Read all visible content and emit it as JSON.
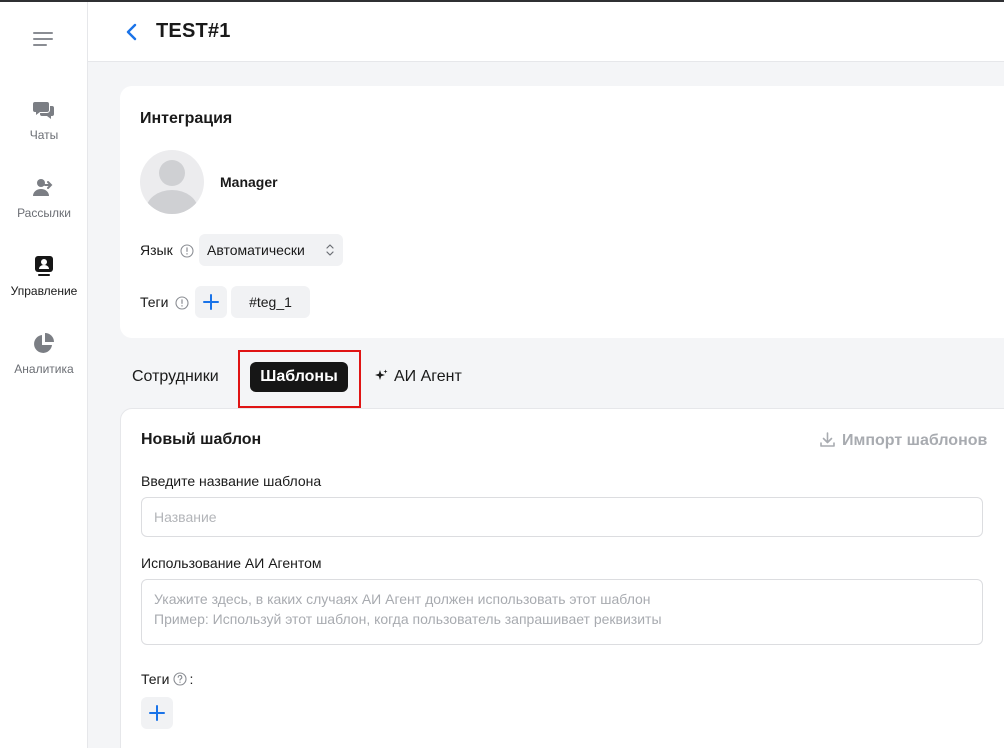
{
  "header": {
    "title": "TEST#1"
  },
  "sidebar": {
    "items": [
      {
        "label": "Чаты",
        "icon": "chats-icon"
      },
      {
        "label": "Рассылки",
        "icon": "mailing-icon"
      },
      {
        "label": "Управление",
        "icon": "management-icon",
        "active": true
      },
      {
        "label": "Аналитика",
        "icon": "analytics-icon"
      }
    ]
  },
  "integration": {
    "title": "Интеграция",
    "manager_name": "Manager",
    "language_label": "Язык",
    "language_value": "Автоматически",
    "tags_label": "Теги",
    "tags": [
      "#teg_1"
    ]
  },
  "tabs": [
    {
      "label": "Сотрудники"
    },
    {
      "label": "Шаблоны",
      "active": true
    },
    {
      "label": "АИ Агент"
    }
  ],
  "template": {
    "title": "Новый шаблон",
    "import_label": "Импорт шаблонов",
    "name_label": "Введите название шаблона",
    "name_placeholder": "Название",
    "usage_label": "Использование АИ Агентом",
    "usage_placeholder_line1": "Укажите здесь, в каких случаях АИ Агент должен использовать этот шаблон",
    "usage_placeholder_line2": "Пример: Используй этот шаблон, когда пользователь запрашивает реквизиты",
    "tags_label": "Теги",
    "tags_suffix": ":"
  },
  "colors": {
    "accent": "#1a73e8",
    "active_tab_bg": "#161616",
    "highlight": "#e01414"
  }
}
